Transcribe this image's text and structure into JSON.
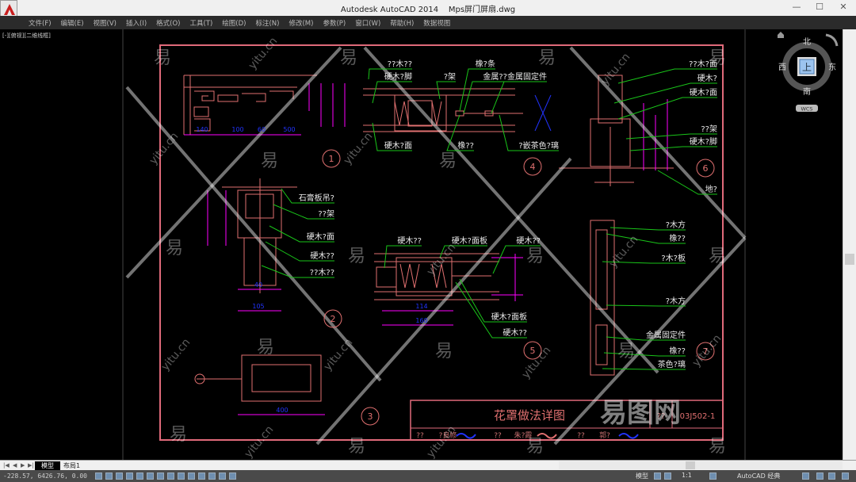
{
  "window": {
    "title": "Autodesk AutoCAD 2014    Mps屏门屏扇.dwg",
    "minimize": "—",
    "maximize": "☐",
    "close": "✕"
  },
  "menu": [
    "文件(F)",
    "编辑(E)",
    "视图(V)",
    "插入(I)",
    "格式(O)",
    "工具(T)",
    "绘图(D)",
    "标注(N)",
    "修改(M)",
    "参数(P)",
    "窗口(W)",
    "帮助(H)",
    "数据视图"
  ],
  "viewport_label": "[-][俯视][二维线框]",
  "navcube": {
    "north": "北",
    "south": "南",
    "east": "东",
    "west": "西",
    "top": "上",
    "wcs": "WCS"
  },
  "drawing": {
    "labels": [
      "??木??",
      "硬木?脚",
      "?架",
      "橡?条",
      "金属??",
      "金属固定件",
      "硬木?面",
      "橡??",
      "?嵌茶色?璃",
      "??木?面",
      "硬木?",
      "硬木?面",
      "??架",
      "硬木?脚",
      "地?",
      "石膏板吊?",
      "??架",
      "硬木?面",
      "硬木??",
      "??木??",
      "硬木??",
      "硬木?面板",
      "硬木??",
      "硬木?面板",
      "硬木??",
      "?木方",
      "橡??",
      "?木?板",
      "?木方",
      "金属固定件",
      "橡??",
      "茶色?璃"
    ],
    "detail_numbers": [
      "1",
      "2",
      "3",
      "4",
      "5",
      "6",
      "7"
    ],
    "dimensions": [
      "140",
      "100",
      "60",
      "500",
      "40",
      "105",
      "114",
      "160",
      "400"
    ],
    "title_block": {
      "title": "花罩做法详图",
      "atlas_label": "??",
      "atlas_number": "03J502-1",
      "row": [
        "??",
        "?良修",
        "??",
        "朱?霞",
        "??",
        "郭?"
      ]
    },
    "watermark": [
      "易",
      "yitu.cn",
      "易图网"
    ]
  },
  "colors": {
    "border": "#e06a7a",
    "leader": "#19c519",
    "dimension": "#2233ff",
    "linework": "#e07070",
    "magenta": "#ff00ff"
  },
  "tabs": {
    "model": "模型",
    "layout1": "布局1"
  },
  "status": {
    "coordinates": "-228.57, 6426.76, 0.00",
    "model": "模型",
    "scale": "1:1",
    "workspace": "AutoCAD 经典"
  }
}
